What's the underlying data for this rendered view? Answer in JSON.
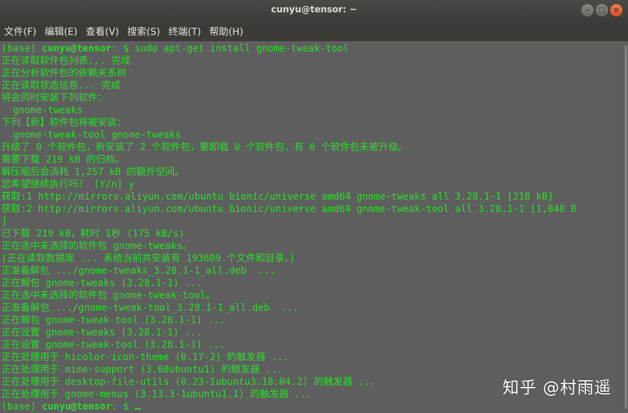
{
  "window": {
    "title": "cunyu@tensor: ~",
    "buttons": {
      "minimize": "–",
      "maximize": "□",
      "close": "×"
    }
  },
  "menu": [
    {
      "id": "file",
      "label": "文件(F)"
    },
    {
      "id": "edit",
      "label": "编辑(E)"
    },
    {
      "id": "view",
      "label": "查看(V)"
    },
    {
      "id": "search",
      "label": "搜索(S)"
    },
    {
      "id": "terminal",
      "label": "终端(T)"
    },
    {
      "id": "help",
      "label": "帮助(H)"
    }
  ],
  "prompt": {
    "env": "(base) ",
    "user": "cunyu@tensor",
    "sep": ":",
    "path": "~",
    "symbol": "$ "
  },
  "command": "sudo apt-get install gnome-tweak-tool",
  "output": [
    "正在读取软件包列表... 完成",
    "正在分析软件包的依赖关系树",
    "正在读取状态信息... 完成",
    "将会同时安装下列软件：",
    "  gnome-tweaks",
    "下列【新】软件包将被安装：",
    "  gnome-tweak-tool gnome-tweaks",
    "升级了 0 个软件包，新安装了 2 个软件包，要卸载 0 个软件包，有 0 个软件包未被升级。",
    "需要下载 219 kB 的归档。",
    "解压缩后会消耗 1,257 kB 的额外空间。",
    "您希望继续执行吗？ [Y/n] y",
    "获取:1 http://mirrors.aliyun.com/ubuntu bionic/universe amd64 gnome-tweaks all 3.28.1-1 [218 kB]",
    "获取:2 http://mirrors.aliyun.com/ubuntu bionic/universe amd64 gnome-tweak-tool all 3.28.1-1 [1,848 B",
    "]",
    "已下载 219 kB，耗时 1秒 (175 kB/s)",
    "正在选中未选择的软件包 gnome-tweaks。",
    "(正在读取数据库 ... 系统当前共安装有 193609 个文件和目录。)",
    "正准备解包 .../gnome-tweaks_3.28.1-1_all.deb  ...",
    "正在解包 gnome-tweaks (3.28.1-1) ...",
    "正在选中未选择的软件包 gnome-tweak-tool。",
    "正准备解包 .../gnome-tweak-tool_3.28.1-1_all.deb  ...",
    "正在解包 gnome-tweak-tool (3.28.1-1) ...",
    "正在设置 gnome-tweaks (3.28.1-1) ...",
    "正在设置 gnome-tweak-tool (3.28.1-1) ...",
    "正在处理用于 hicolor-icon-theme (0.17-2) 的触发器 ...",
    "正在处理用于 mime-support (3.60ubuntu1) 的触发器 ...",
    "正在处理用于 desktop-file-utils (0.23-1ubuntu3.18.04.2) 的触发器 ...",
    "正在处理用于 gnome-menus (3.13.3-1ubuntu1.1) 的触发器 ..."
  ],
  "watermark": "知乎 @村雨遥",
  "colors": {
    "terminal_bg": "#5e5e5e",
    "text": "#28e028",
    "path": "#3f5fe0",
    "titlebar": "#3c3b37",
    "close_button": "#e9541f"
  }
}
